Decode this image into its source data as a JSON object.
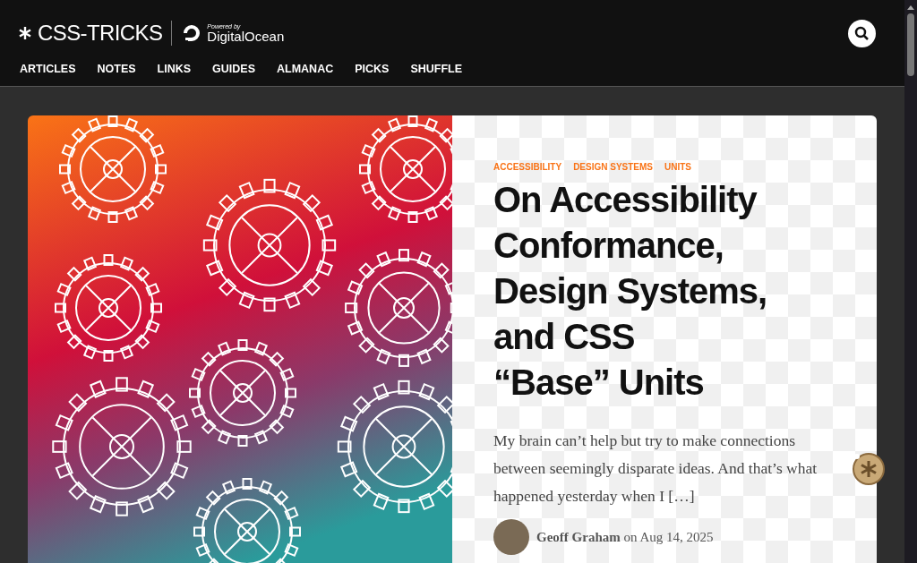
{
  "header": {
    "logo": "CSS-TRICKS",
    "sponsor_caption": "Powered by",
    "sponsor": "DigitalOcean"
  },
  "nav": [
    "ARTICLES",
    "NOTES",
    "LINKS",
    "GUIDES",
    "ALMANAC",
    "PICKS",
    "SHUFFLE"
  ],
  "article": {
    "tags": [
      "ACCESSIBILITY",
      "DESIGN SYSTEMS",
      "UNITS"
    ],
    "title_lines": [
      "On Accessibility",
      "Conformance,",
      "Design Systems,",
      "and CSS",
      "“Base” Units"
    ],
    "excerpt": "My brain can’t help but try to make connections between seemingly disparate ideas. And that’s what happened yesterday when I […]",
    "byline": "**Geoff Graham** on Aug 14, 2025"
  }
}
